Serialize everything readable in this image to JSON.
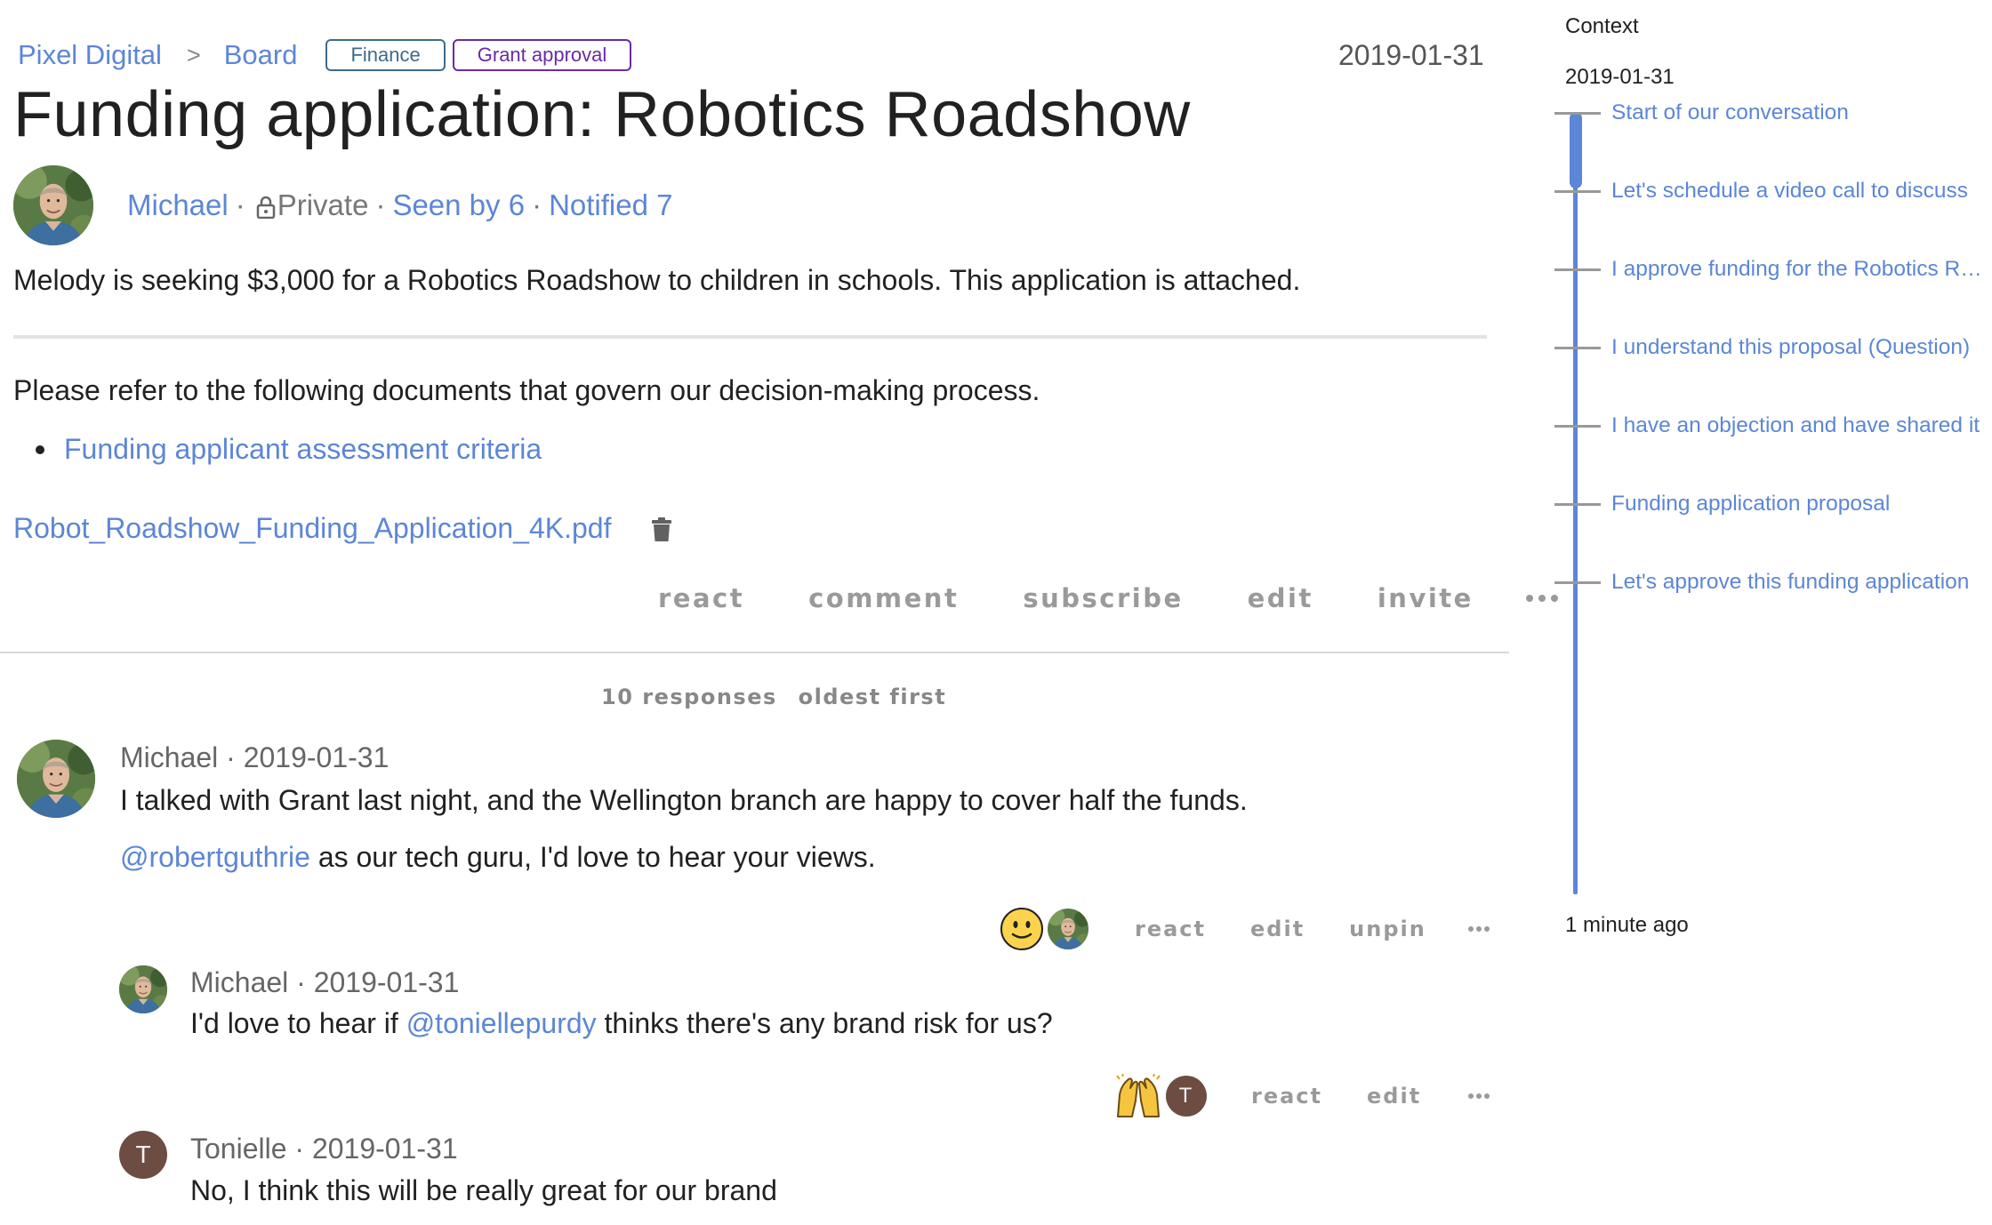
{
  "breadcrumb": {
    "org": "Pixel Digital",
    "separator": ">",
    "board": "Board",
    "tags": [
      "Finance",
      "Grant approval"
    ]
  },
  "header": {
    "date": "2019-01-31",
    "title": "Funding application: Robotics Roadshow"
  },
  "meta": {
    "author": "Michael",
    "privacy": "Private",
    "seen_by": "Seen by 6",
    "notified": "Notified 7",
    "separator": "·"
  },
  "description": "Melody is seeking $3,000 for a Robotics Roadshow to children in schools. This application is attached.",
  "documents": {
    "intro": "Please refer to the following documents that govern our decision-making process.",
    "links": [
      "Funding applicant assessment criteria"
    ]
  },
  "attachment": {
    "filename": "Robot_Roadshow_Funding_Application_4K.pdf",
    "icon": "trash-icon"
  },
  "discussion_actions": [
    "react",
    "comment",
    "subscribe",
    "edit",
    "invite"
  ],
  "responses": {
    "count_label": "10 responses",
    "sort_label": "oldest first"
  },
  "comments": [
    {
      "author": "Michael",
      "date": "2019-01-31",
      "header": "Michael · 2019-01-31",
      "line1": "I talked with Grant last night, and the Wellington branch are happy to cover half the funds.",
      "mention": "@robertguthrie",
      "line2_rest": " as our tech guru, I'd love to hear your views.",
      "reaction": "slightly-smiling-face-icon",
      "actions": [
        "react",
        "edit",
        "unpin"
      ]
    },
    {
      "author": "Michael",
      "date": "2019-01-31",
      "header": "Michael · 2019-01-31",
      "prefix": "I'd love to hear if ",
      "mention": "@toniellepurdy",
      "suffix": " thinks there's any brand risk for us?",
      "reaction": "raised-hands-icon",
      "reactor_initial": "T",
      "actions": [
        "react",
        "edit"
      ]
    },
    {
      "author": "Tonielle",
      "initial": "T",
      "date": "2019-01-31",
      "header": "Tonielle · 2019-01-31",
      "text": "No, I think this will be really great for our brand"
    }
  ],
  "context": {
    "title": "Context",
    "date": "2019-01-31",
    "items": [
      "Start of our conversation",
      "Let's schedule a video call to discuss",
      "I approve funding for the Robotics Roadshow",
      "I understand this proposal (Question)",
      "I have an objection and have shared it",
      "Funding application proposal",
      "Let's approve this funding application"
    ],
    "ago": "1 minute ago"
  },
  "colors": {
    "link": "#5c86d6",
    "finance_tag": "#3e6a8c",
    "grant_tag": "#6a2aa8",
    "timeline": "#5c86d6",
    "letter_avatar": "#6d4c41"
  }
}
